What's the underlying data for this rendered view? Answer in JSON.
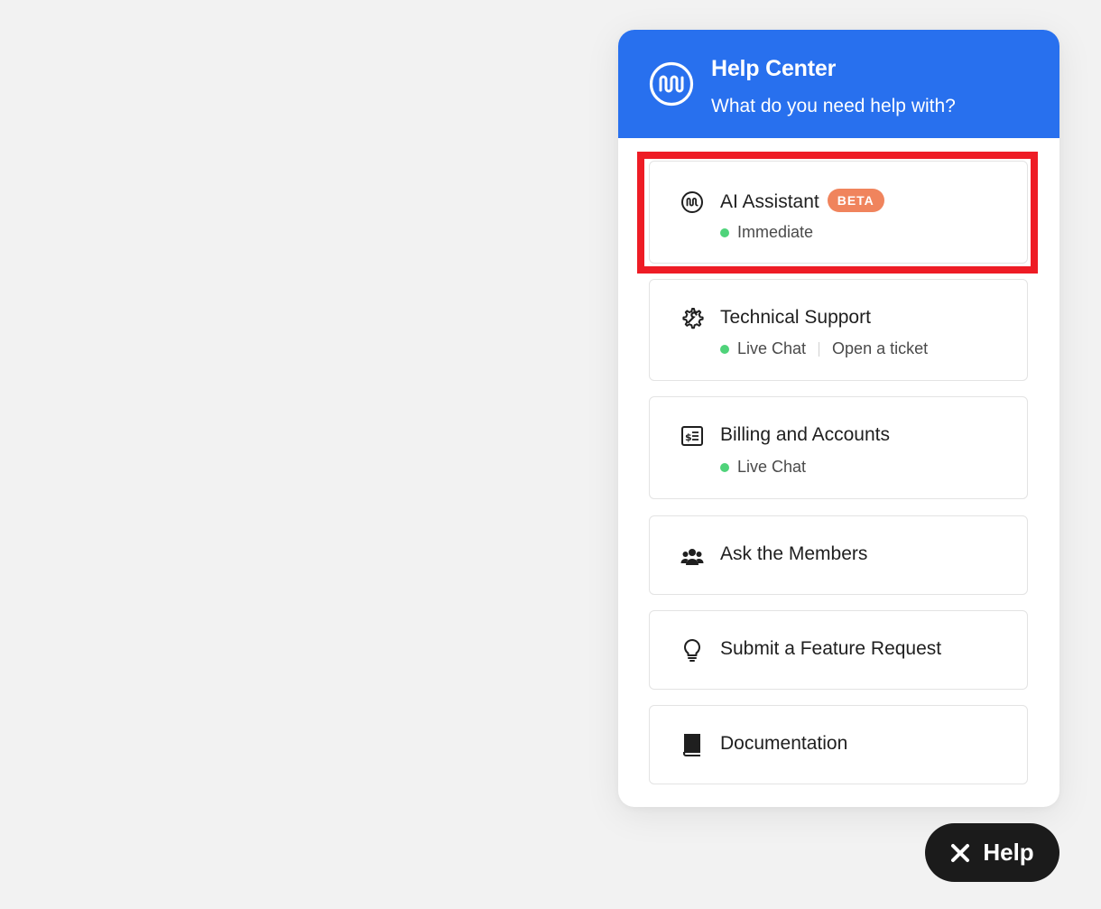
{
  "header": {
    "title": "Help Center",
    "subtitle": "What do you need help with?",
    "logo_icon": "wave-logo-icon",
    "background_color": "#2870ee"
  },
  "options": [
    {
      "title": "AI Assistant",
      "badge": "BETA",
      "icon": "wave-logo-icon",
      "status": "Immediate",
      "highlighted": true
    },
    {
      "title": "Technical Support",
      "icon": "gear-wrench-icon",
      "status": "Live Chat",
      "secondary_link": "Open a ticket"
    },
    {
      "title": "Billing and Accounts",
      "icon": "invoice-icon",
      "status": "Live Chat"
    },
    {
      "title": "Ask the Members",
      "icon": "users-icon"
    },
    {
      "title": "Submit a Feature Request",
      "icon": "lightbulb-icon"
    },
    {
      "title": "Documentation",
      "icon": "book-icon"
    }
  ],
  "help_button": {
    "label": "Help",
    "icon": "close-icon"
  },
  "colors": {
    "status_online": "#4fd37a",
    "beta_badge": "#f0845d",
    "highlight_border": "#ee1c25",
    "help_button": "#1b1b1b"
  }
}
